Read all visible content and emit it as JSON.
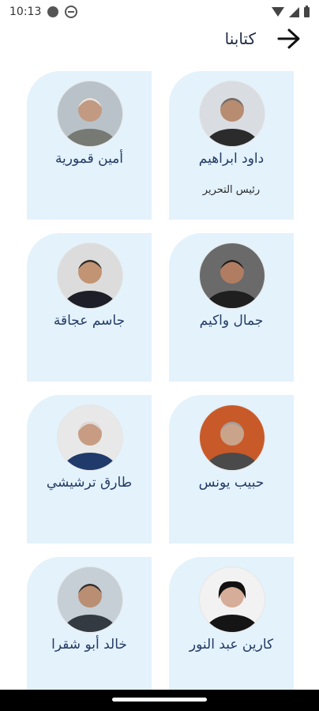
{
  "status": {
    "time": "10:13"
  },
  "header": {
    "title": "كتابنا"
  },
  "writers": [
    {
      "name": "داود ابراهيم",
      "role": "رئيس التحرير",
      "avatar_colors": {
        "bg": "#d9dde2",
        "hair": "#6b6b6b",
        "skin": "#b88c70",
        "clothes": "#2b2b2b"
      }
    },
    {
      "name": "أمين قمورية",
      "role": "",
      "avatar_colors": {
        "bg": "#b9c2c8",
        "hair": "#e9e9e9",
        "skin": "#c29a82",
        "clothes": "#777a73"
      }
    },
    {
      "name": "جمال واكيم",
      "role": "",
      "avatar_colors": {
        "bg": "#6a6a6a",
        "hair": "#1a1a1a",
        "skin": "#b07d62",
        "clothes": "#1f1f1f"
      }
    },
    {
      "name": "جاسم عجاقة",
      "role": "",
      "avatar_colors": {
        "bg": "#dcdcdc",
        "hair": "#2a2a2a",
        "skin": "#c29474",
        "clothes": "#1e1e28"
      }
    },
    {
      "name": "حبيب يونس",
      "role": "",
      "avatar_colors": {
        "bg": "#c85a2a",
        "hair": "#9f9f9f",
        "skin": "#caa48a",
        "clothes": "#4a4a4a"
      }
    },
    {
      "name": "طارق ترشيشي",
      "role": "",
      "avatar_colors": {
        "bg": "#e8e8e8",
        "hair": "#dedede",
        "skin": "#c79c82",
        "clothes": "#1f3a6b"
      }
    },
    {
      "name": "كارين عبد النور",
      "role": "",
      "avatar_colors": {
        "bg": "#f2f2f2",
        "hair": "#111111",
        "skin": "#d6ad98",
        "clothes": "#151515"
      }
    },
    {
      "name": "خالد أبو شقرا",
      "role": "",
      "avatar_colors": {
        "bg": "#c6ced6",
        "hair": "#2e2e2e",
        "skin": "#b98e73",
        "clothes": "#333a41"
      }
    }
  ]
}
